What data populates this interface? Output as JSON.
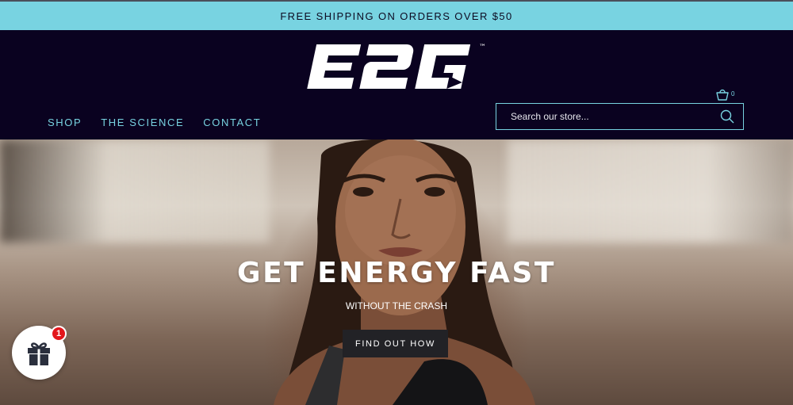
{
  "announcement": {
    "text": "FREE SHIPPING ON ORDERS OVER $50"
  },
  "brand": {
    "name": "E2G",
    "trademark": "™"
  },
  "cart": {
    "count": "0"
  },
  "nav": {
    "items": [
      {
        "label": "SHOP"
      },
      {
        "label": "THE SCIENCE"
      },
      {
        "label": "CONTACT"
      }
    ]
  },
  "search": {
    "placeholder": "Search our store..."
  },
  "hero": {
    "title": "GET ENERGY FAST",
    "subtitle": "WITHOUT THE CRASH",
    "button_label": "FIND OUT HOW"
  },
  "gift": {
    "badge_count": "1"
  },
  "colors": {
    "accent": "#78d3e1",
    "header_bg": "#0a0220",
    "button_bg": "#222226",
    "badge": "#e3161b"
  },
  "icons": [
    "cart-icon",
    "search-icon",
    "gift-icon"
  ]
}
